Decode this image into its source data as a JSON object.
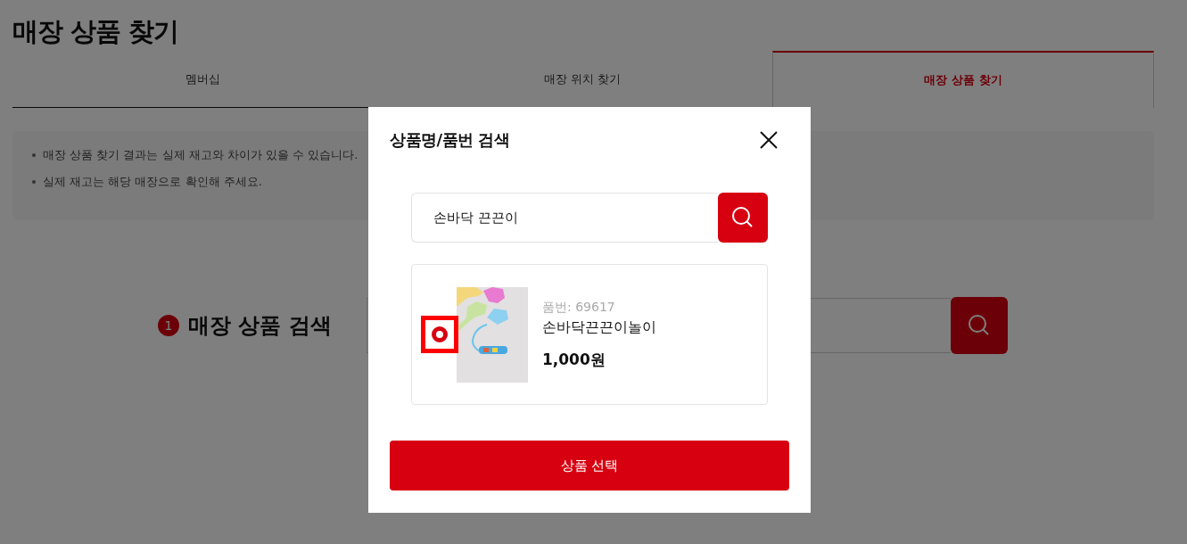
{
  "page_title": "매장 상품 찾기",
  "tabs": [
    {
      "label": "멤버십",
      "selected": false
    },
    {
      "label": "매장 위치 찾기",
      "selected": false
    },
    {
      "label": "매장 상품 찾기",
      "selected": true
    }
  ],
  "notices": [
    "매장 상품 찾기 결과는 실제 재고와 차이가 있을 수 있습니다.",
    "실제 재고는 해당 매장으로 확인해 주세요."
  ],
  "step": {
    "number": "1",
    "title": "매장 상품 검색"
  },
  "modal": {
    "title": "상품명/품번 검색",
    "search": {
      "value": "손바닥 끈끈이"
    },
    "results": [
      {
        "selected": true,
        "highlighted": true,
        "code": "품번: 69617",
        "name": "손바닥끈끈이놀이",
        "price": "1,000원"
      }
    ],
    "confirm_button": "상품 선택"
  }
}
